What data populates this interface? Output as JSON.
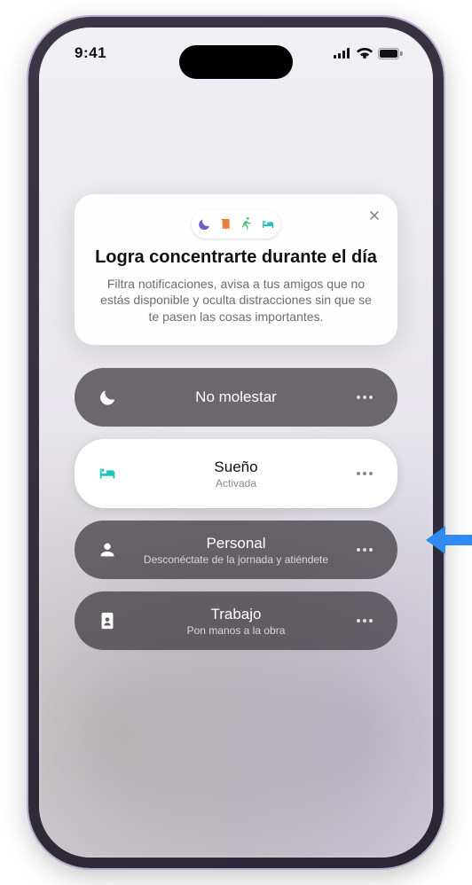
{
  "status": {
    "time": "9:41"
  },
  "card": {
    "title": "Logra concentrarte durante el día",
    "body": "Filtra notificaciones, avisa a tus amigos que no estás disponible y oculta distracciones sin que se te pasen las cosas importantes.",
    "icons": [
      "moon-icon",
      "book-icon",
      "runner-icon",
      "bed-icon"
    ],
    "icon_colors": [
      "#6b5ecb",
      "#ef7d3a",
      "#39c66d",
      "#1cc6bd"
    ]
  },
  "focus_items": [
    {
      "name": "do-not-disturb",
      "label": "No molestar",
      "sub": "",
      "icon": "moon-icon",
      "variant": "dark"
    },
    {
      "name": "sleep",
      "label": "Sueño",
      "sub": "Activada",
      "icon": "bed-icon",
      "variant": "light",
      "icon_color": "#1cc6bd"
    },
    {
      "name": "personal",
      "label": "Personal",
      "sub": "Desconéctate de la jornada y atiéndete",
      "icon": "person-icon",
      "variant": "dark"
    },
    {
      "name": "work",
      "label": "Trabajo",
      "sub": "Pon manos a la obra",
      "icon": "badge-icon",
      "variant": "dark"
    }
  ],
  "callout": {
    "arrow_color": "#2f8af2"
  }
}
